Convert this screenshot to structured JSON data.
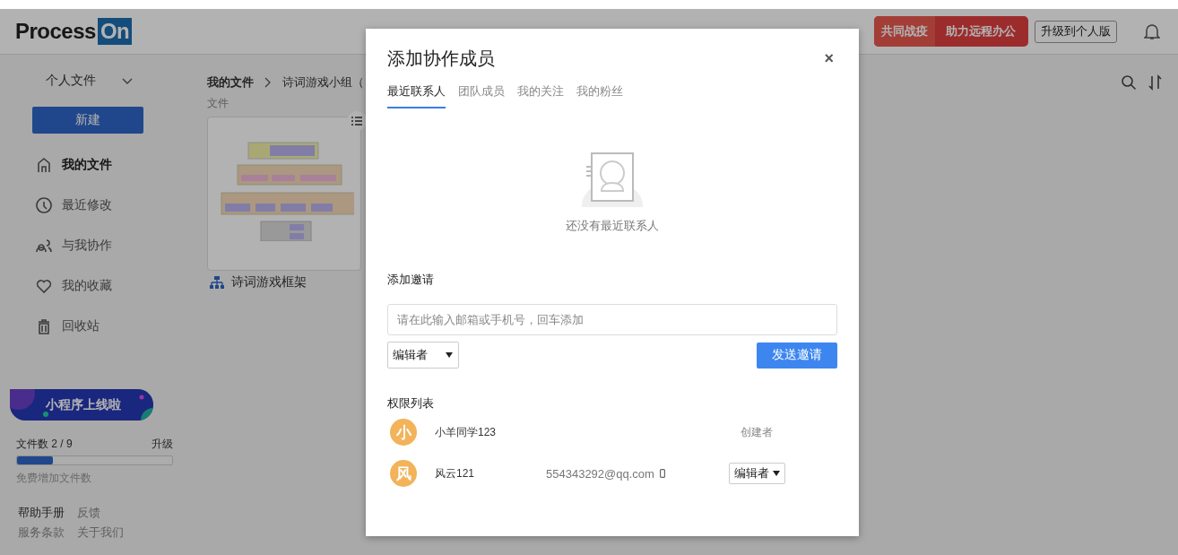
{
  "header": {
    "logo": {
      "word": "Process",
      "mark": "On"
    },
    "campaign": [
      "共同战疫",
      "助力远程办公"
    ],
    "upgrade_button": "升级到个人版"
  },
  "sidebar": {
    "space_selector": "个人文件",
    "new_button": "新建",
    "items": [
      {
        "label": "我的文件",
        "selected": true
      },
      {
        "label": "最近修改",
        "selected": false
      },
      {
        "label": "与我协作",
        "selected": false
      },
      {
        "label": "我的收藏",
        "selected": false
      },
      {
        "label": "回收站",
        "selected": false
      }
    ],
    "promo": "小程序上线啦",
    "quota": {
      "label": "文件数 2 / 9",
      "upgrade": "升级",
      "level": 0.23,
      "hint": "免费增加文件数"
    },
    "footer_links": [
      [
        "帮助手册",
        "反馈"
      ],
      [
        "服务条款",
        "关于我们"
      ]
    ]
  },
  "main": {
    "breadcrumb": [
      "我的文件",
      "诗词游戏小组（"
    ],
    "section_label": "文件",
    "files": [
      {
        "name": "诗词游戏框架"
      }
    ]
  },
  "dialog": {
    "title": "添加协作成员",
    "close": "×",
    "tabs": [
      {
        "label": "最近联系人",
        "selected": true
      },
      {
        "label": "团队成员",
        "selected": false
      },
      {
        "label": "我的关注",
        "selected": false
      },
      {
        "label": "我的粉丝",
        "selected": false
      }
    ],
    "empty_text": "还没有最近联系人",
    "invite_label": "添加邀请",
    "invite_field": {
      "placeholder": "请在此输入邮箱或手机号，回车添加"
    },
    "role_select": "编辑者",
    "send_button": "发送邀请",
    "permissions_label": "权限列表",
    "members": [
      {
        "avatar": "小",
        "name": "小羊同学123",
        "kind": "owner",
        "role": "创建者"
      },
      {
        "avatar": "风",
        "name": "风云121",
        "email": "554343292@qq.com",
        "kind": "editable",
        "role": "编辑者"
      }
    ]
  }
}
